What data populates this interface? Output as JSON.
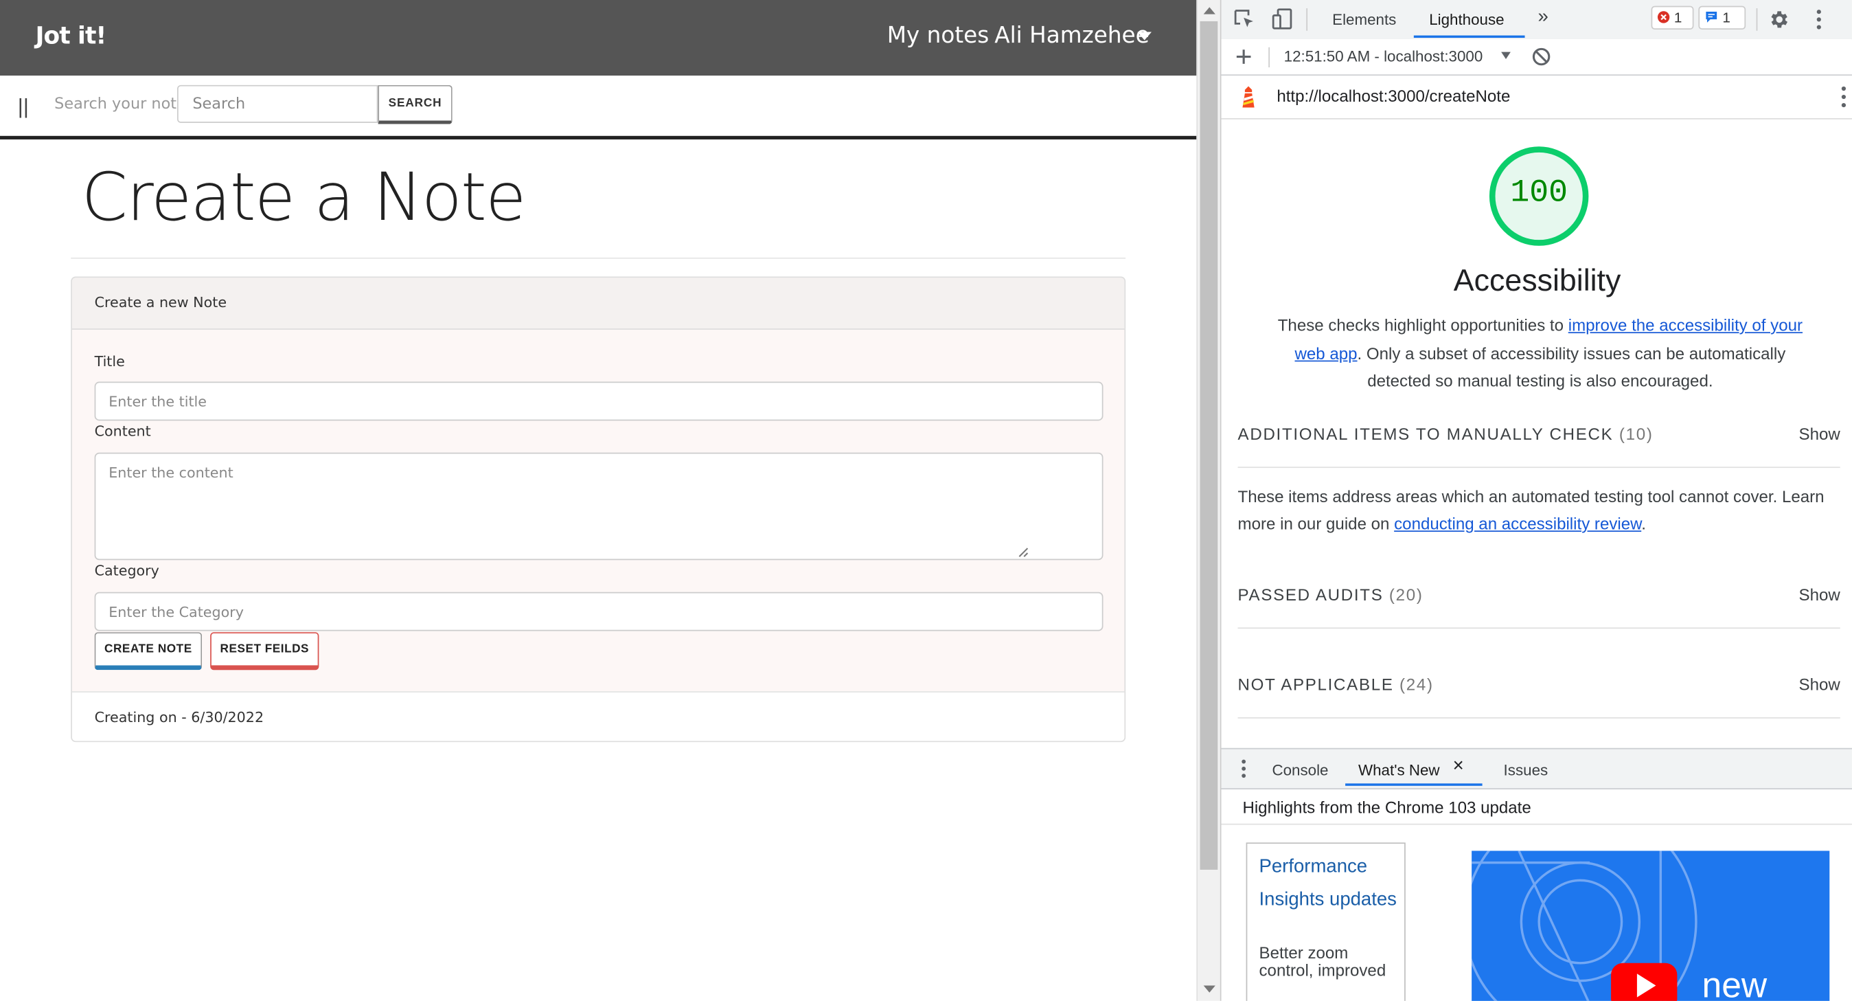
{
  "navbar": {
    "brand": "Jot it!",
    "my_notes": "My notes",
    "user_name": "Ali Hamzehee"
  },
  "searchbar": {
    "toggle": "||",
    "label": "Search your notes",
    "placeholder": "Search",
    "button": "SEARCH"
  },
  "page": {
    "title": "Create a Note"
  },
  "form": {
    "header": "Create a new Note",
    "title_label": "Title",
    "title_placeholder": "Enter the title",
    "content_label": "Content",
    "content_placeholder": "Enter the content",
    "category_label": "Category",
    "category_placeholder": "Enter the Category",
    "create_button": "CREATE NOTE",
    "reset_button": "RESET FEILDS",
    "footer": "Creating on - 6/30/2022"
  },
  "devtools": {
    "tabs": [
      "Elements",
      "Lighthouse"
    ],
    "active_tab": "Lighthouse",
    "more_tabs": "»",
    "error_count": "1",
    "message_count": "1",
    "report_label": "12:51:50 AM - localhost:3000",
    "url": "http://localhost:3000/createNote",
    "score": "100",
    "category": "Accessibility",
    "description": {
      "prefix": "These checks highlight opportunities to ",
      "link": "improve the accessibility of your web app",
      "suffix": ". Only a subset of accessibility issues can be automatically detected so manual testing is also encouraged."
    },
    "sections": [
      {
        "title": "ADDITIONAL ITEMS TO MANUALLY CHECK",
        "count": "(10)",
        "action": "Show"
      },
      {
        "title": "PASSED AUDITS",
        "count": "(20)",
        "action": "Show"
      },
      {
        "title": "NOT APPLICABLE",
        "count": "(24)",
        "action": "Show"
      }
    ],
    "manual_desc": {
      "prefix": "These items address areas which an automated testing tool cannot cover. Learn more in our guide on ",
      "link": "conducting an accessibility review",
      "suffix": "."
    },
    "drawer": {
      "tabs": [
        "Console",
        "What's New",
        "Issues"
      ],
      "active_tab": "What's New",
      "close": "×",
      "highlights": "Highlights from the Chrome 103 update",
      "card_title": "Performance Insights updates",
      "card_text": "Better zoom control, improved",
      "video_text": "new"
    },
    "colors": {
      "accent": "#1a73e8",
      "score_green": "#0cce6b",
      "link": "#1558d6",
      "error_red": "#d93025"
    }
  }
}
